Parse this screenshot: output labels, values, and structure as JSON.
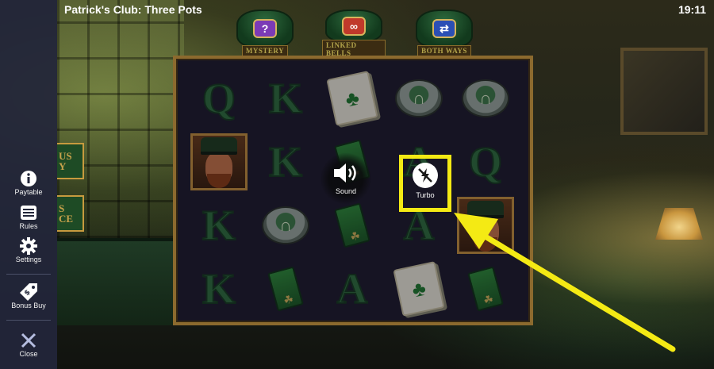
{
  "window": {
    "title": "Patrick's Club: Three Pots",
    "clock": "19:11"
  },
  "sidebar": {
    "items": [
      {
        "label": "Paytable",
        "icon": "info-icon"
      },
      {
        "label": "Rules",
        "icon": "list-icon"
      },
      {
        "label": "Settings",
        "icon": "gear-icon"
      },
      {
        "label": "Bonus Buy",
        "icon": "price-tag-icon"
      },
      {
        "label": "Close",
        "icon": "close-icon"
      }
    ]
  },
  "pots": [
    {
      "label": "MYSTERY",
      "symbol": "?",
      "color": "#7b3bb6"
    },
    {
      "label": "LINKED BELLS",
      "symbol": "∞",
      "color": "#c0392b"
    },
    {
      "label": "BOTH WAYS",
      "symbol": "⇄",
      "color": "#2b4fb5"
    }
  ],
  "left_stubs": [
    {
      "text": "US\nY"
    },
    {
      "text": "S\nCE"
    }
  ],
  "reels": [
    [
      "Q",
      "portrait",
      "K",
      "K"
    ],
    [
      "K",
      "K",
      "ring",
      "lighter"
    ],
    [
      "card",
      "lighter",
      "lighter",
      "A"
    ],
    [
      "ring",
      "A",
      "A",
      "card"
    ],
    [
      "ring",
      "Q",
      "portrait",
      "lighter"
    ]
  ],
  "overlay": {
    "sound_label": "Sound",
    "turbo_label": "Turbo"
  },
  "colors": {
    "highlight": "#f4ea14",
    "sidebar_bg": "#22263a",
    "frame_gold": "#8c6a2e"
  }
}
